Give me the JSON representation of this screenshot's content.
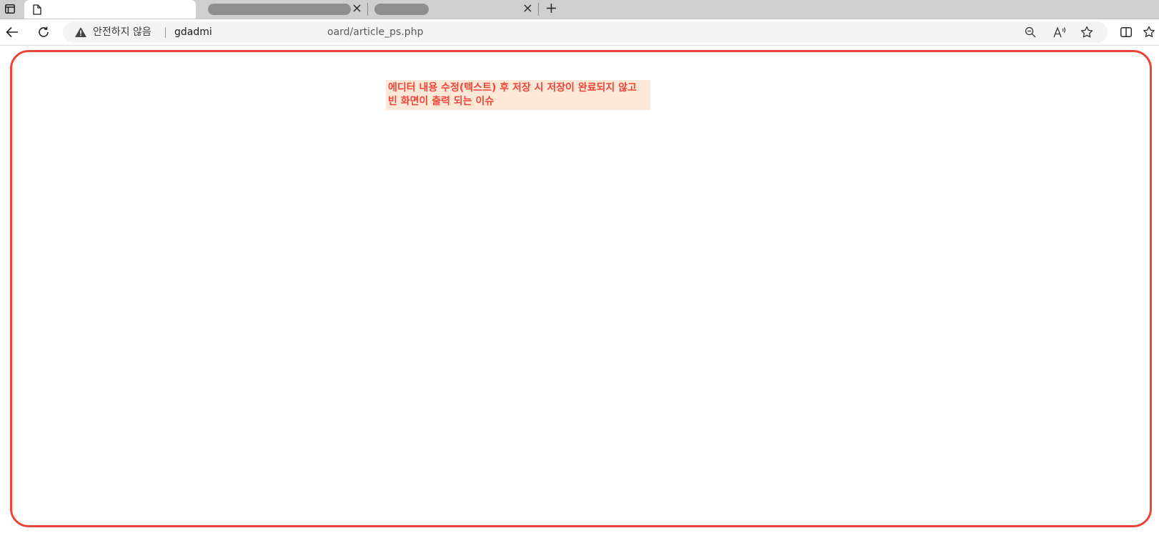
{
  "browser": {
    "tabs": [
      {
        "title": "",
        "active": true,
        "icon": "document-icon"
      },
      {
        "title": "",
        "active": false,
        "redacted": true
      },
      {
        "title": "",
        "active": false,
        "redacted": true
      }
    ],
    "address_bar": {
      "security_label": "안전하지 않음",
      "url_visible_start": "gdadmi",
      "url_visible_end": "oard/article_ps.php"
    },
    "icons": {
      "tab_actions": "tab-actions-icon",
      "back": "back-arrow-icon",
      "refresh": "refresh-icon",
      "warning": "warning-triangle-icon",
      "zoom": "zoom-out-icon",
      "read_aloud": "read-aloud-icon",
      "favorite": "star-icon",
      "split_screen": "split-screen-icon",
      "favorites": "favorites-icon",
      "close": "close-icon",
      "new_tab": "plus-icon"
    }
  },
  "content": {
    "issue_note_line1": "에디터 내용 수정(텍스트) 후 저장 시 저장이 완료되지 않고",
    "issue_note_line2": "빈 화면이 출력 되는 이슈",
    "frame_color": "#ee4536",
    "note_text_color": "#f0463a",
    "note_bg_color": "#fde8d8"
  }
}
